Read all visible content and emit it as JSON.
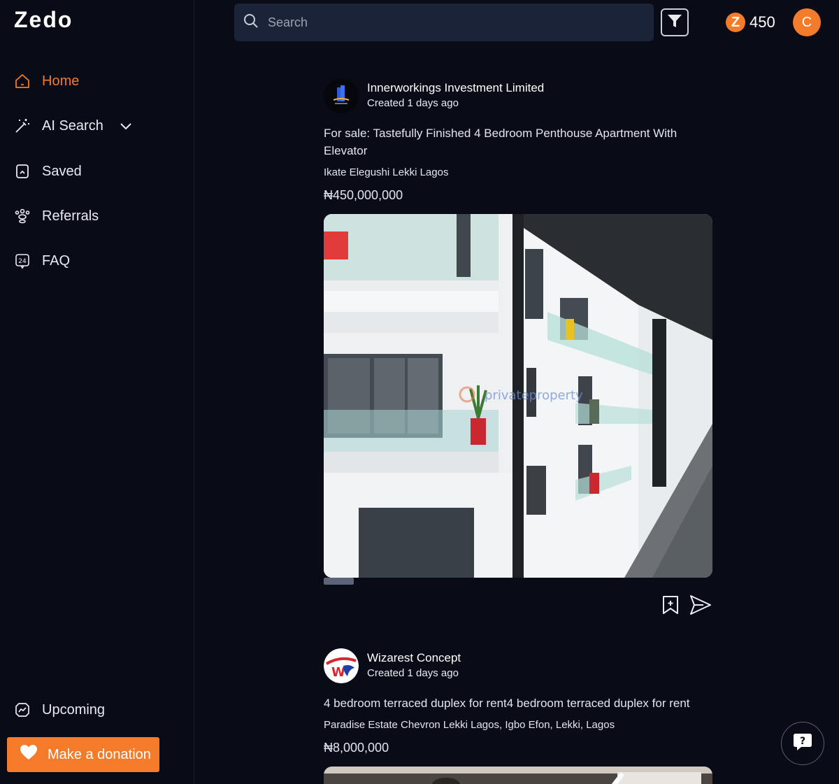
{
  "app": {
    "logo": "Zedo"
  },
  "sidebar": {
    "items": [
      {
        "label": "Home",
        "icon": "home-icon",
        "active": true
      },
      {
        "label": "AI Search",
        "icon": "magic-wand-icon",
        "active": false
      },
      {
        "label": "Saved",
        "icon": "bookmark-icon",
        "active": false
      },
      {
        "label": "Referrals",
        "icon": "people-icon",
        "active": false
      },
      {
        "label": "FAQ",
        "icon": "24-hour-support-icon",
        "active": false
      }
    ],
    "upcoming": {
      "label": "Upcoming",
      "icon": "trending-chart-icon"
    },
    "donate_label": "Make a donation"
  },
  "search": {
    "placeholder": "Search"
  },
  "header": {
    "points": "450",
    "points_badge": "Z",
    "avatar_initial": "C"
  },
  "posts": [
    {
      "company": "Innerworkings Investment Limited",
      "created": "Created 1 days ago",
      "title": "For sale: Tastefully Finished 4 Bedroom Penthouse Apartment With Elevator",
      "location": "Ikate Elegushi Lekki Lagos",
      "price": "₦450,000,000",
      "watermark": "privateproperty"
    },
    {
      "company": "Wizarest Concept",
      "created": "Created 1 days ago",
      "title": "4 bedroom terraced duplex for rent4 bedroom terraced duplex for rent",
      "location": "Paradise Estate Chevron Lekki Lagos, Igbo Efon, Lekki, Lagos",
      "price": "₦8,000,000"
    }
  ],
  "colors": {
    "accent": "#f47b2a",
    "background": "#090c16",
    "search_bg": "#1a2338"
  }
}
